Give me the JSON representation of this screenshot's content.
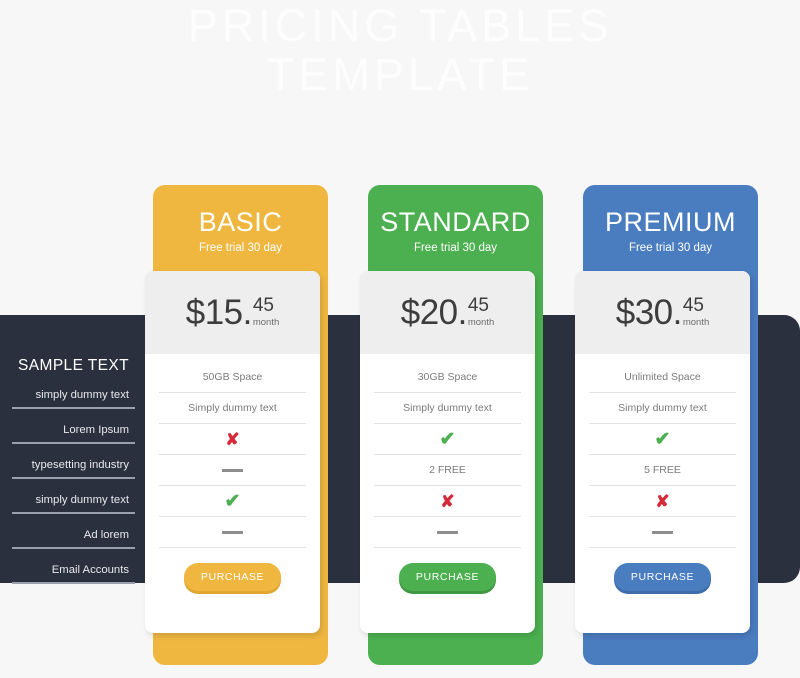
{
  "page": {
    "title_line1": "PRICING TABLES",
    "title_line2": "TEMPLATE",
    "background_color": "#f7f7f7",
    "title_color": "#fdfdfd"
  },
  "sidebar": {
    "heading": "SAMPLE TEXT",
    "background_color": "#2b303e",
    "rows": [
      {
        "label": "simply dummy text"
      },
      {
        "label": "Lorem Ipsum"
      },
      {
        "label": "typesetting industry"
      },
      {
        "label": "simply dummy text"
      },
      {
        "label": "Ad lorem"
      },
      {
        "label": "Email Accounts"
      }
    ]
  },
  "plans": [
    {
      "name": "BASIC",
      "subtitle": "Free trial 30 day",
      "accent_color": "#efb740",
      "accent_dark": "#e0a62f",
      "price_main": "$15.",
      "price_cents": "45",
      "price_period": "month",
      "features": [
        {
          "type": "text",
          "value": "50GB Space"
        },
        {
          "type": "text",
          "value": "Simply dummy text"
        },
        {
          "type": "cross",
          "value": "✘"
        },
        {
          "type": "dash",
          "value": ""
        },
        {
          "type": "check",
          "value": "✔"
        },
        {
          "type": "dash",
          "value": ""
        }
      ],
      "button_label": "PURCHASE"
    },
    {
      "name": "STANDARD",
      "subtitle": "Free trial 30 day",
      "accent_color": "#4cb050",
      "accent_dark": "#3f9943",
      "price_main": "$20.",
      "price_cents": "45",
      "price_period": "month",
      "features": [
        {
          "type": "text",
          "value": "30GB Space"
        },
        {
          "type": "text",
          "value": "Simply dummy text"
        },
        {
          "type": "check",
          "value": "✔"
        },
        {
          "type": "text",
          "value": "2 FREE"
        },
        {
          "type": "cross",
          "value": "✘"
        },
        {
          "type": "dash",
          "value": ""
        }
      ],
      "button_label": "PURCHASE"
    },
    {
      "name": "PREMIUM",
      "subtitle": "Free trial 30 day",
      "accent_color": "#4a7cc0",
      "accent_dark": "#3f6cab",
      "price_main": "$30.",
      "price_cents": "45",
      "price_period": "month",
      "features": [
        {
          "type": "text",
          "value": "Unlimited Space"
        },
        {
          "type": "text",
          "value": "Simply dummy text"
        },
        {
          "type": "check",
          "value": "✔"
        },
        {
          "type": "text",
          "value": "5 FREE"
        },
        {
          "type": "cross",
          "value": "✘"
        },
        {
          "type": "dash",
          "value": ""
        }
      ],
      "button_label": "PURCHASE"
    }
  ]
}
